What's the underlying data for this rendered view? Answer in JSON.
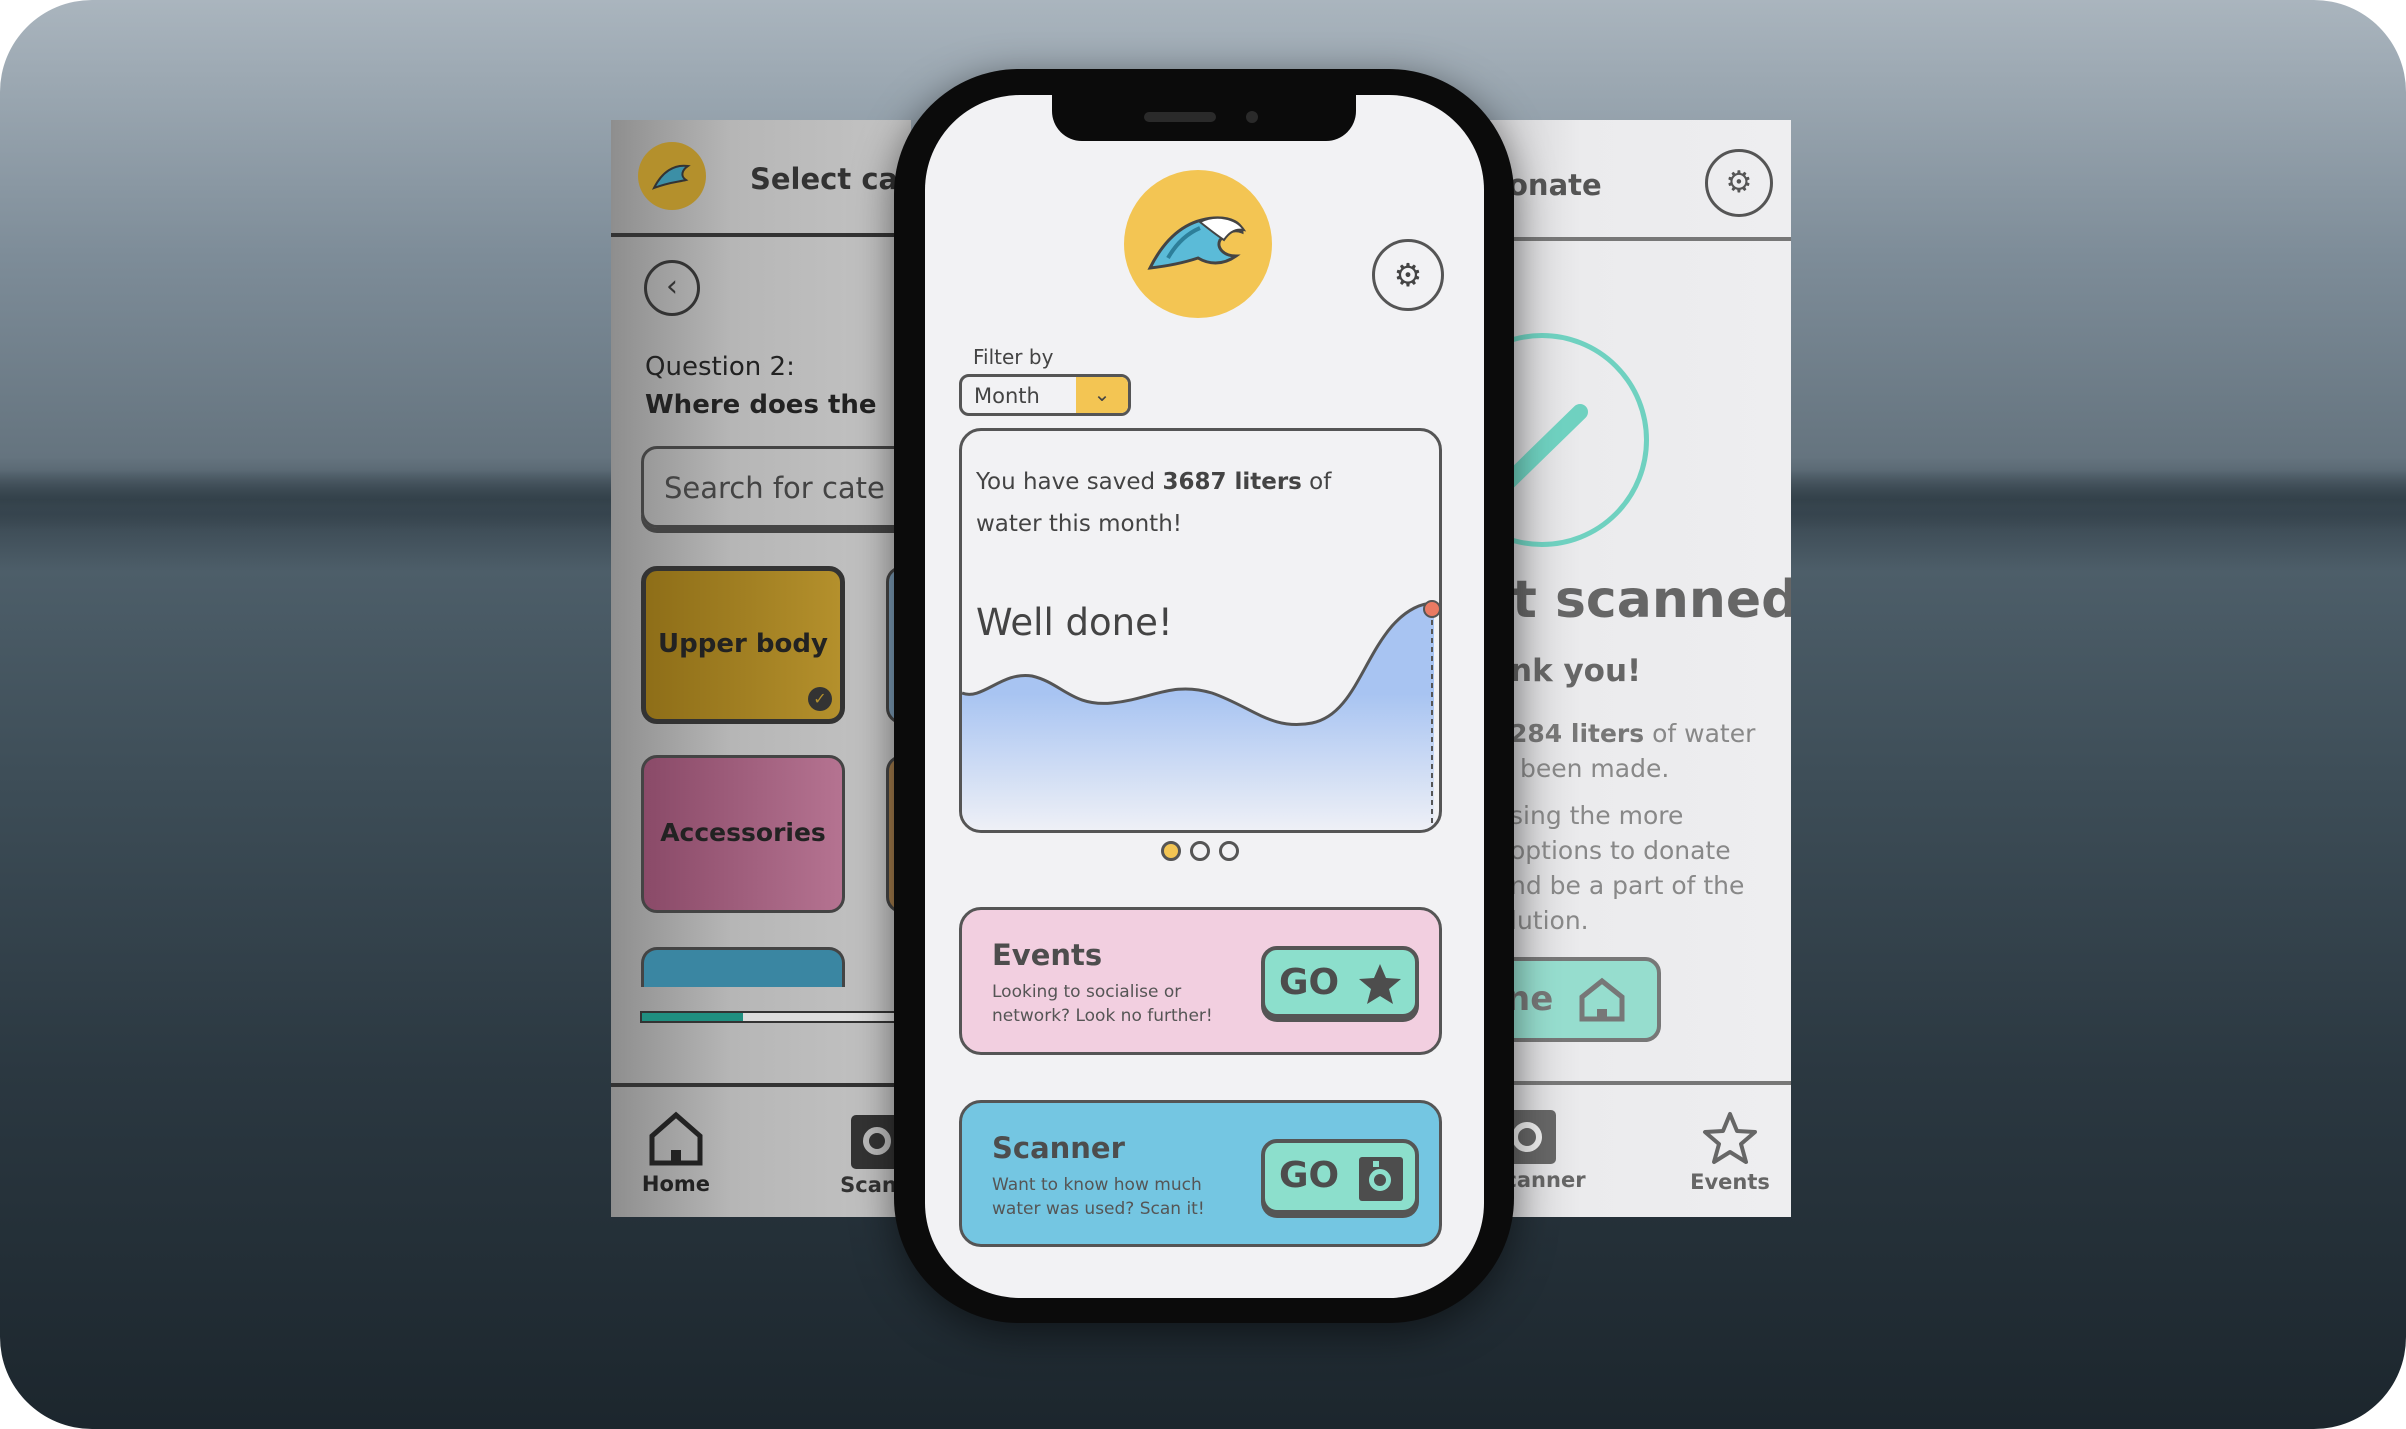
{
  "left_screen": {
    "title": "Select cat",
    "question_label": "Question 2:",
    "question_text": "Where does the",
    "search_placeholder": "Search for cate",
    "categories": [
      {
        "label": "Upper body",
        "color": "#b4902c",
        "selected": true
      },
      {
        "label": "Accessories",
        "color": "#b06a8a",
        "selected": false
      }
    ],
    "progress": 0.34,
    "nav": {
      "home": "Home",
      "scanner": "Scann"
    }
  },
  "center_screen": {
    "filter": {
      "label": "Filter by",
      "value": "Month"
    },
    "summary": {
      "prefix": "You have saved ",
      "amount": "3687 liters",
      "suffix": " of",
      "line2": "water this month!"
    },
    "headline": "Well done!",
    "page_dots": {
      "count": 3,
      "active": 0
    },
    "events_card": {
      "title": "Events",
      "desc1": "Looking to socialise or",
      "desc2": "network? Look no further!",
      "button": "GO",
      "color": "#f2cfe0"
    },
    "scanner_card": {
      "title": "Scanner",
      "desc1": "Want to know how much",
      "desc2": "water was used? Scan it!",
      "button": "GO",
      "color": "#74c6e2"
    },
    "accent": "#f3c553"
  },
  "right_screen": {
    "title": "onate",
    "heading": "t scanned",
    "thanks": "nk you!",
    "line1_bold": "284 liters",
    "line1_rest": " of water",
    "line2": "been made.",
    "line3": "sing the more",
    "line4": "options to donate",
    "line5": "nd be a part of the",
    "line6": "lution.",
    "home_button": "ne",
    "nav": {
      "scanner": "canner",
      "events": "Events"
    }
  }
}
